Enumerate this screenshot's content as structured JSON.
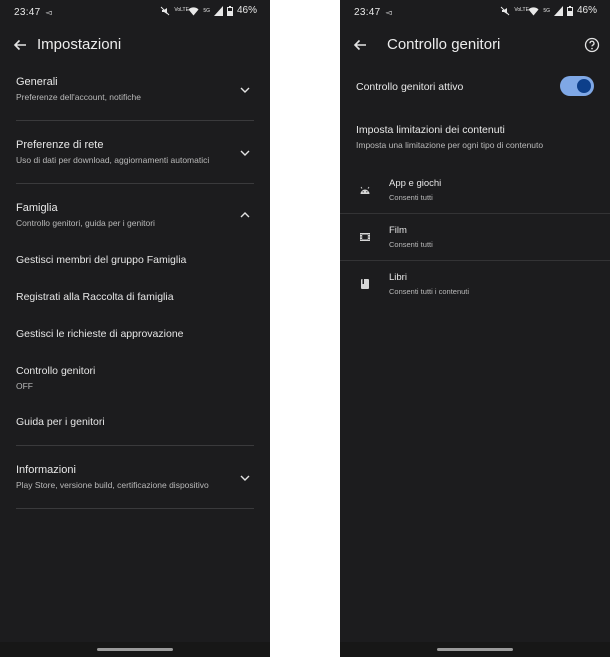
{
  "status": {
    "time": "23:47",
    "nav_glyph": "◅",
    "battery": "46%",
    "net": "5G",
    "volte": "VoLTE"
  },
  "left": {
    "title": "Impostazioni",
    "sections": [
      {
        "title": "Generali",
        "subtitle": "Preferenze dell'account, notifiche",
        "expanded": false
      },
      {
        "title": "Preferenze di rete",
        "subtitle": "Uso di dati per download, aggiornamenti automatici",
        "expanded": false
      },
      {
        "title": "Famiglia",
        "subtitle": "Controllo genitori, guida per i genitori",
        "expanded": true
      },
      {
        "title": "Informazioni",
        "subtitle": "Play Store, versione build, certificazione dispositivo",
        "expanded": false
      }
    ],
    "family_items": [
      {
        "label": "Gestisci membri del gruppo Famiglia"
      },
      {
        "label": "Registrati alla Raccolta di famiglia"
      },
      {
        "label": "Gestisci le richieste di approvazione"
      },
      {
        "label": "Controllo genitori",
        "sub": "OFF"
      },
      {
        "label": "Guida per i genitori"
      }
    ]
  },
  "right": {
    "title": "Controllo genitori",
    "toggle_label": "Controllo genitori attivo",
    "toggle_on": true,
    "restrictions_title": "Imposta limitazioni dei contenuti",
    "restrictions_subtitle": "Imposta una limitazione per ogni tipo di contenuto",
    "items": [
      {
        "icon": "android-icon",
        "title": "App e giochi",
        "subtitle": "Consenti tutti"
      },
      {
        "icon": "film-icon",
        "title": "Film",
        "subtitle": "Consenti tutti"
      },
      {
        "icon": "book-icon",
        "title": "Libri",
        "subtitle": "Consenti tutti i contenuti"
      }
    ]
  },
  "colors": {
    "background": "#1c1c1e",
    "toggle_track": "#7fa8e6",
    "toggle_knob": "#0d3f8a",
    "divider": "#3a3a3c"
  }
}
